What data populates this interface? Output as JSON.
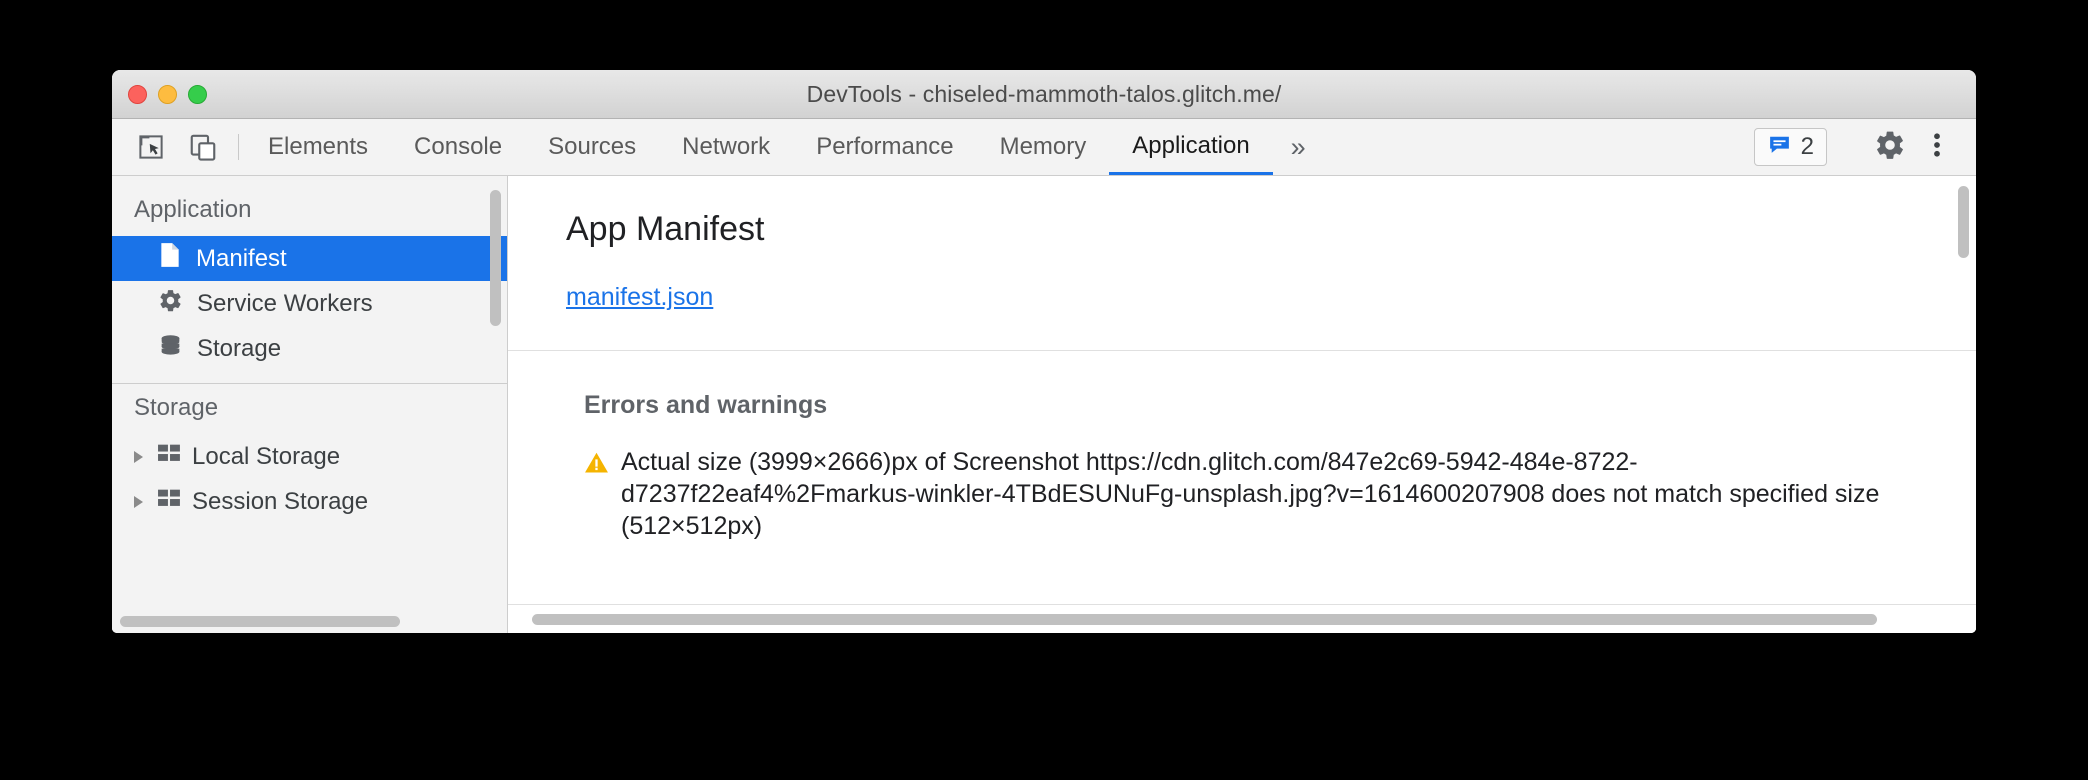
{
  "window": {
    "title": "DevTools - chiseled-mammoth-talos.glitch.me/",
    "traffic_lights": {
      "close": "close-window",
      "minimize": "minimize-window",
      "maximize": "maximize-window"
    }
  },
  "toolbar": {
    "inspect_icon": "inspect-element-icon",
    "device_icon": "device-toolbar-icon",
    "tabs": [
      {
        "label": "Elements",
        "active": false
      },
      {
        "label": "Console",
        "active": false
      },
      {
        "label": "Sources",
        "active": false
      },
      {
        "label": "Network",
        "active": false
      },
      {
        "label": "Performance",
        "active": false
      },
      {
        "label": "Memory",
        "active": false
      },
      {
        "label": "Application",
        "active": true
      }
    ],
    "overflow_label": "»",
    "messages": {
      "icon": "message-bubble-icon",
      "count": "2",
      "color": "#1a73e8"
    },
    "settings_icon": "gear-icon",
    "more_icon": "more-vertical-icon"
  },
  "sidebar": {
    "groups": [
      {
        "title": "Application",
        "items": [
          {
            "label": "Manifest",
            "icon": "document-icon",
            "selected": true,
            "expandable": false
          },
          {
            "label": "Service Workers",
            "icon": "gear-icon",
            "selected": false,
            "expandable": false
          },
          {
            "label": "Storage",
            "icon": "database-icon",
            "selected": false,
            "expandable": false
          }
        ]
      },
      {
        "title": "Storage",
        "items": [
          {
            "label": "Local Storage",
            "icon": "table-icon",
            "selected": false,
            "expandable": true
          },
          {
            "label": "Session Storage",
            "icon": "table-icon",
            "selected": false,
            "expandable": true
          }
        ]
      }
    ],
    "selection_color": "#1a73e8"
  },
  "main": {
    "heading": "App Manifest",
    "manifest_link": "manifest.json",
    "errors_heading": "Errors and warnings",
    "warning": {
      "icon": "warning-triangle-icon",
      "color": "#f5b400",
      "text": "Actual size (3999×2666)px of Screenshot https://cdn.glitch.com/847e2c69-5942-484e-8722-d7237f22eaf4%2Fmarkus-winkler-4TBdESUNuFg-unsplash.jpg?v=1614600207908 does not match specified size (512×512px)"
    }
  }
}
